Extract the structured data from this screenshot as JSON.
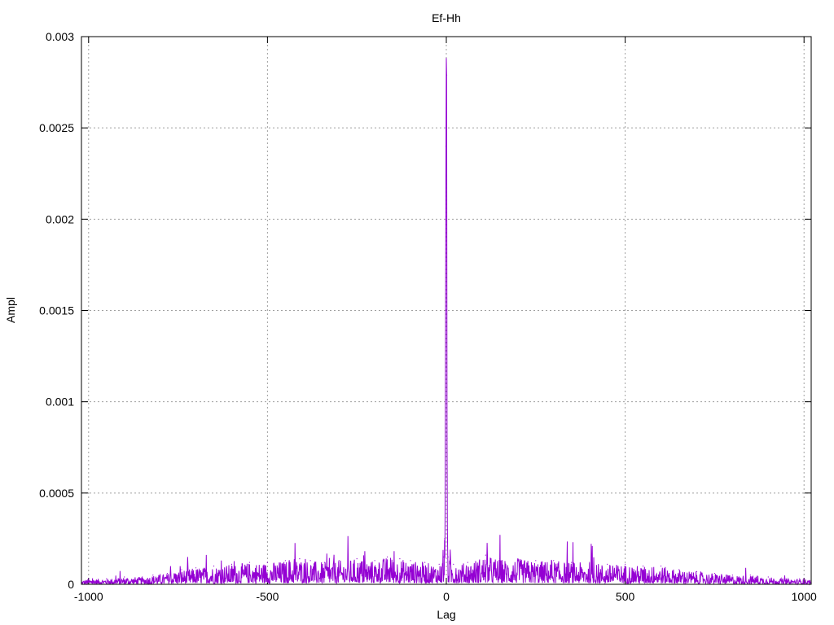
{
  "chart_data": {
    "type": "line",
    "title": "Ef-Hh",
    "xlabel": "Lag",
    "ylabel": "Ampl",
    "xlim": [
      -1020,
      1020
    ],
    "ylim": [
      0,
      0.003
    ],
    "x_ticks": [
      -1000,
      -500,
      0,
      500,
      1000
    ],
    "x_tick_labels": [
      "-1000",
      "-500",
      "0",
      "500",
      "1000"
    ],
    "y_ticks": [
      0,
      0.0005,
      0.001,
      0.0015,
      0.002,
      0.0025,
      0.003
    ],
    "y_tick_labels": [
      "0",
      "0.0005",
      "0.001",
      "0.0015",
      "0.002",
      "0.0025",
      "0.003"
    ],
    "grid": true,
    "legend": "none",
    "series": [
      {
        "color": "#9400d3",
        "points": [
          [
            -1020,
            2e-05
          ],
          [
            -1000,
            3e-05
          ],
          [
            -950,
            3e-05
          ],
          [
            -900,
            4e-05
          ],
          [
            -850,
            4e-05
          ],
          [
            -820,
            5e-05
          ],
          [
            -780,
            6e-05
          ],
          [
            -740,
            8e-05
          ],
          [
            -700,
            9e-05
          ],
          [
            -650,
            0.0001
          ],
          [
            -600,
            0.00011
          ],
          [
            -550,
            0.00012
          ],
          [
            -500,
            0.00012
          ],
          [
            -450,
            0.00013
          ],
          [
            -410,
            0.00014
          ],
          [
            -380,
            0.00013
          ],
          [
            -340,
            0.00012
          ],
          [
            -300,
            0.00013
          ],
          [
            -250,
            0.00014
          ],
          [
            -200,
            0.00013
          ],
          [
            -165,
            0.00015
          ],
          [
            -130,
            0.00014
          ],
          [
            -100,
            0.00013
          ],
          [
            -60,
            0.00012
          ],
          [
            -20,
            0.00011
          ],
          [
            -8,
            0.00015
          ],
          [
            -5,
            0.00025
          ],
          [
            -3,
            0.0006
          ],
          [
            -2,
            0.0015
          ],
          [
            -1,
            0.0024
          ],
          [
            0,
            0.00288
          ],
          [
            1,
            0.00279
          ],
          [
            2,
            0.0008
          ],
          [
            3,
            0.0003
          ],
          [
            5,
            0.00015
          ],
          [
            20,
            0.00011
          ],
          [
            60,
            0.00012
          ],
          [
            110,
            0.00016
          ],
          [
            150,
            0.00014
          ],
          [
            200,
            0.00014
          ],
          [
            250,
            0.00013
          ],
          [
            300,
            0.00013
          ],
          [
            350,
            0.00012
          ],
          [
            400,
            0.00012
          ],
          [
            450,
            0.00011
          ],
          [
            500,
            0.00011
          ],
          [
            550,
            0.0001
          ],
          [
            600,
            0.0001
          ],
          [
            650,
            8e-05
          ],
          [
            700,
            7e-05
          ],
          [
            750,
            6e-05
          ],
          [
            800,
            5e-05
          ],
          [
            850,
            5e-05
          ],
          [
            900,
            4e-05
          ],
          [
            950,
            3e-05
          ],
          [
            1000,
            3e-05
          ],
          [
            1020,
            2e-05
          ]
        ]
      }
    ]
  }
}
